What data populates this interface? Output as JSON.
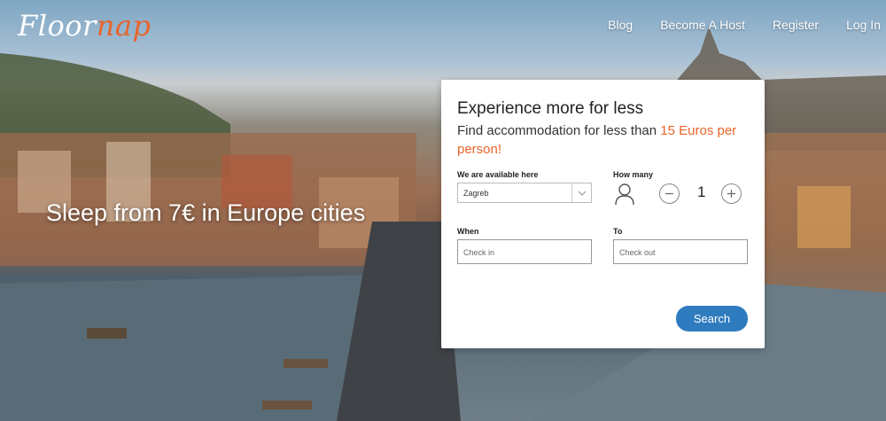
{
  "header": {
    "logo_part1": "Floor",
    "logo_part2": "nap",
    "nav": [
      "Blog",
      "Become A Host",
      "Register",
      "Log In"
    ]
  },
  "hero": {
    "tagline": "Sleep from 7€ in Europe cities"
  },
  "search_card": {
    "title": "Experience more for less",
    "subtitle_prefix": "Find accommodation for less than ",
    "subtitle_highlight": "15 Euros per person!",
    "location_label": "We are available here",
    "location_value": "Zagreb",
    "guests_label": "How many",
    "guests_value": "1",
    "when_label": "When",
    "checkin_placeholder": "Check in",
    "to_label": "To",
    "checkout_placeholder": "Check out",
    "search_button": "Search"
  },
  "colors": {
    "brand_orange": "#e8642a",
    "button_blue": "#2f7bbf"
  }
}
